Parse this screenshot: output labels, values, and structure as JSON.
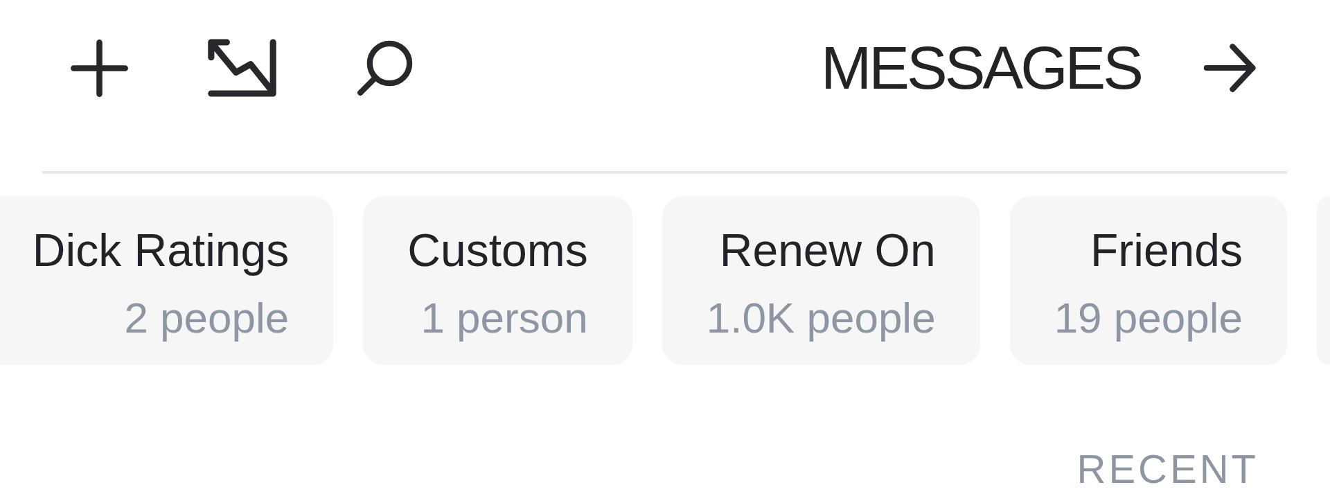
{
  "header": {
    "title": "MESSAGES"
  },
  "groups": [
    {
      "name": "Dick Ratings",
      "count": "2 people"
    },
    {
      "name": "Customs",
      "count": "1 person"
    },
    {
      "name": "Renew On",
      "count": "1.0K people"
    },
    {
      "name": "Friends",
      "count": "19 people"
    }
  ],
  "section": {
    "title": "RECENT"
  }
}
